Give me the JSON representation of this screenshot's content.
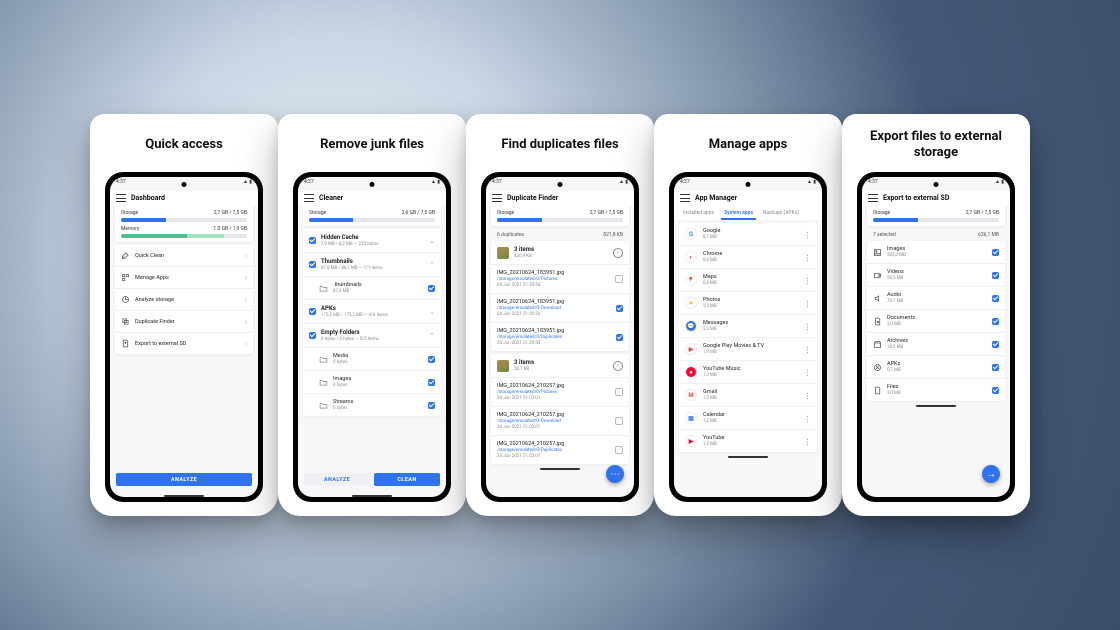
{
  "status_time": "4:37",
  "cards": [
    {
      "title": "Quick access"
    },
    {
      "title": "Remove junk files"
    },
    {
      "title": "Find duplicates files"
    },
    {
      "title": "Manage apps"
    },
    {
      "title": "Export files  to external storage"
    }
  ],
  "dashboard": {
    "title": "Dashboard",
    "storage": {
      "label": "Storage",
      "value": "2,7 GB / 7,5 GB",
      "pct": 36
    },
    "memory": {
      "label": "Memory",
      "value": "1.0 GB / 1,9 GB",
      "used_pct": 52,
      "free_pct": 30
    },
    "items": [
      {
        "label": "Quick Clean"
      },
      {
        "label": "Manage Apps"
      },
      {
        "label": "Analyze storage"
      },
      {
        "label": "Duplicate Finder"
      },
      {
        "label": "Export to external SD"
      }
    ],
    "cta": "ANALYZE"
  },
  "cleaner": {
    "title": "Cleaner",
    "storage": {
      "label": "Storage",
      "value": "2,6 GB / 7,5 GB",
      "pct": 35
    },
    "groups": [
      {
        "name": "Hidden Cache",
        "sub": "7,9 MB / 8,2 MB — 235 items",
        "checked": true
      },
      {
        "name": "Thumbnails",
        "sub": "87,6 MB / 88,1 MB — 1/1 items",
        "checked": true,
        "children": [
          {
            "name": ".thumbnails",
            "sub": "87,6 MB",
            "checked": true
          }
        ]
      },
      {
        "name": "APKs",
        "sub": "175,2 MB / 175,2 MB — 4/4 items",
        "checked": true
      },
      {
        "name": "Empty Folders",
        "sub": "0 bytes / 0 bytes — 5/5 items",
        "checked": true,
        "children": [
          {
            "name": "Media",
            "sub": "0 bytes",
            "checked": true
          },
          {
            "name": "Images",
            "sub": "0 bytes",
            "checked": true
          },
          {
            "name": "Streams",
            "sub": "0 bytes",
            "checked": true
          }
        ]
      }
    ],
    "cta_secondary": "ANALYZE",
    "cta_primary": "CLEAN"
  },
  "dup": {
    "title": "Duplicate Finder",
    "storage": {
      "label": "Storage",
      "value": "2,7 GB / 7,5 GB",
      "pct": 36
    },
    "summary": {
      "count": "6 duplicates",
      "size": "821,8 KB"
    },
    "groups": [
      {
        "header": {
          "label": "3 items",
          "size": "430,9 KB"
        },
        "files": [
          {
            "name": "IMG_20210624_183951.jpg",
            "path": "/storage/emulated/0/Pictures",
            "date": "24 Jun 2021  21:39:54"
          },
          {
            "name": "IMG_20210624_183951.jpg",
            "path": "/storage/emulated/0/Download",
            "date": "24 Jun 2021  21:39:54",
            "checked": true
          },
          {
            "name": "IMG_20210624_183951.jpg",
            "path": "/storage/emulated/0/Duplicates",
            "date": "24 Jun 2021  21:39:54",
            "checked": true
          }
        ]
      },
      {
        "header": {
          "label": "3 items",
          "size": "56,1 KB"
        },
        "files": [
          {
            "name": "IMG_20210624_210257.jpg",
            "path": "/storage/emulated/0/Pictures",
            "date": "24 Jun 2021  21:03:01"
          },
          {
            "name": "IMG_20210624_210257.jpg",
            "path": "/storage/emulated/0/Download",
            "date": "24 Jun 2021  21:03:01"
          },
          {
            "name": "IMG_20210624_210257.jpg",
            "path": "/storage/emulated/0/Duplicates",
            "date": "24 Jun 2021  21:03:01"
          }
        ]
      }
    ]
  },
  "apps": {
    "title": "App Manager",
    "tabs": [
      "Installed apps",
      "System apps",
      "Backups (APKs)"
    ],
    "active_tab": 1,
    "list": [
      {
        "name": "Google",
        "size": "8,7 MB",
        "color": "#fff",
        "glyph": "G",
        "gcolor": "#4285F4"
      },
      {
        "name": "Chrome",
        "size": "6,4 MB",
        "color": "#fff",
        "glyph": "◐",
        "gcolor": "#ea4335"
      },
      {
        "name": "Maps",
        "size": "6,4 MB",
        "color": "#fff",
        "glyph": "📍",
        "gcolor": "#34a853"
      },
      {
        "name": "Photos",
        "size": "5,5 MB",
        "color": "#fff",
        "glyph": "✦",
        "gcolor": "#fbbc04"
      },
      {
        "name": "Messages",
        "size": "2,3 MB",
        "color": "#3b78e7",
        "glyph": "💬",
        "gcolor": "#fff"
      },
      {
        "name": "Google Play Movies & TV",
        "size": "1,9 MB",
        "color": "#fff",
        "glyph": "▶",
        "gcolor": "#ea4335"
      },
      {
        "name": "YouTube Music",
        "size": "1,3 MB",
        "color": "#ff0032",
        "glyph": "●",
        "gcolor": "#fff"
      },
      {
        "name": "Gmail",
        "size": "1,2 MB",
        "color": "#fff",
        "glyph": "M",
        "gcolor": "#ea4335"
      },
      {
        "name": "Calendar",
        "size": "1,2 MB",
        "color": "#fff",
        "glyph": "▦",
        "gcolor": "#4285F4"
      },
      {
        "name": "YouTube",
        "size": "1,2 MB",
        "color": "#fff",
        "glyph": "▶",
        "gcolor": "#ff0032"
      }
    ]
  },
  "export": {
    "title": "Export to external SD",
    "storage": {
      "label": "Storage",
      "value": "2,7 GB / 7,5 GB",
      "pct": 36
    },
    "summary": {
      "count": "7 selected",
      "size": "636,1 MB"
    },
    "items": [
      {
        "name": "Images",
        "size": "505,0 MB",
        "icon": "image"
      },
      {
        "name": "Videos",
        "size": "56,0 MB",
        "icon": "video"
      },
      {
        "name": "Audio",
        "size": "70,1 MB",
        "icon": "audio"
      },
      {
        "name": "Documents",
        "size": "3,0 MB",
        "icon": "doc"
      },
      {
        "name": "Archives",
        "size": "18,2 MB",
        "icon": "archive"
      },
      {
        "name": "APKs",
        "size": "0,7 MB",
        "icon": "apk"
      },
      {
        "name": "Files",
        "size": "3,0 MB",
        "icon": "file"
      }
    ]
  }
}
